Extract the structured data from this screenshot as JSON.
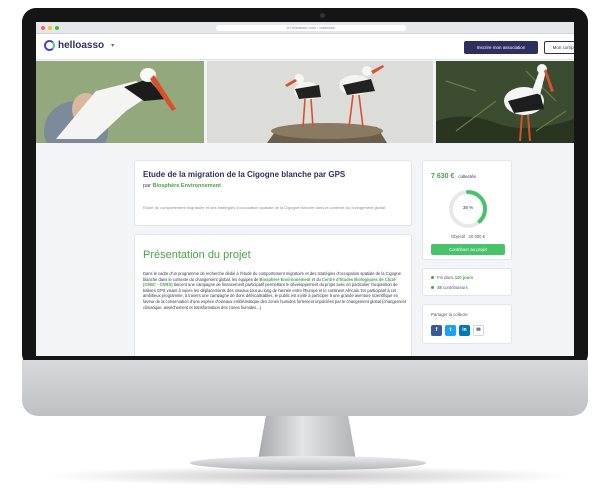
{
  "browser": {
    "url": "fr.helloasso.com / collectes",
    "dot_colors": [
      "#ff5f57",
      "#febc2e",
      "#28c840"
    ]
  },
  "header": {
    "logo_text": "helloasso",
    "register_label": "Inscrire mon association",
    "account_label": "Mon compte"
  },
  "project": {
    "title": "Etude de la migration de la Cigogne blanche par GPS",
    "by_prefix": "par",
    "organization": "Biosphère Environnement",
    "description": "Etude du comportement migratoire et des stratégies d'occupation spatiale de la Cigogne blanche dans le contexte du changement global"
  },
  "presentation": {
    "title": "Présentation du projet",
    "p1": "Dans le cadre d'un programme de recherche dédié à l'étude du comportement migratoire et des stratégies d'occupation spatiale de la Cigogne blanche dans le contexte du changement global, les équipes de",
    "org1": "Biosphère Environnement",
    "p2": "et du",
    "org2": "Centre d'Etudes Biologiques de Chizé (CEBC - CNRS)",
    "p3": "lancent une campagne de financement participatif permettant le développement du projet avec en particulier l'acquisition de balises GPS visant à suivre les déplacements des oiseaux tout au long de l'année entre l'Europe et le continent Africain. En participant à cet ambitieux programme, à travers une campagne de dons défiscalisables, le public est invité à participer à une grande aventure scientifique en faveur de la conservation d'une espèce d'oiseaux emblématique des zones humides fortement impactées par le changement global (changement climatique, assèchement et transformation des zones humides...)"
  },
  "funding": {
    "amount": "7 630 €",
    "amount_suffix": "collectés",
    "percent_label": "38 %",
    "progress": 0.38,
    "objective": "Objectif : 20 000 €",
    "contribute_label": "Contribuer au projet"
  },
  "stats": {
    "days_prefix": "Fin dans",
    "days_value": "110 jours",
    "contributors_value": "38",
    "contributors_suffix": "contributeurs"
  },
  "share": {
    "label": "Partager la collecte",
    "buttons": [
      {
        "glyph": "f",
        "color": "#3b5998"
      },
      {
        "glyph": "t",
        "color": "#1da1f2"
      },
      {
        "glyph": "in",
        "color": "#0077b5"
      },
      {
        "glyph": "✉",
        "color": "#ffffff"
      }
    ]
  },
  "colors": {
    "brand_navy": "#2e2f5e",
    "brand_green": "#49a34b",
    "button_green": "#49c36a"
  }
}
